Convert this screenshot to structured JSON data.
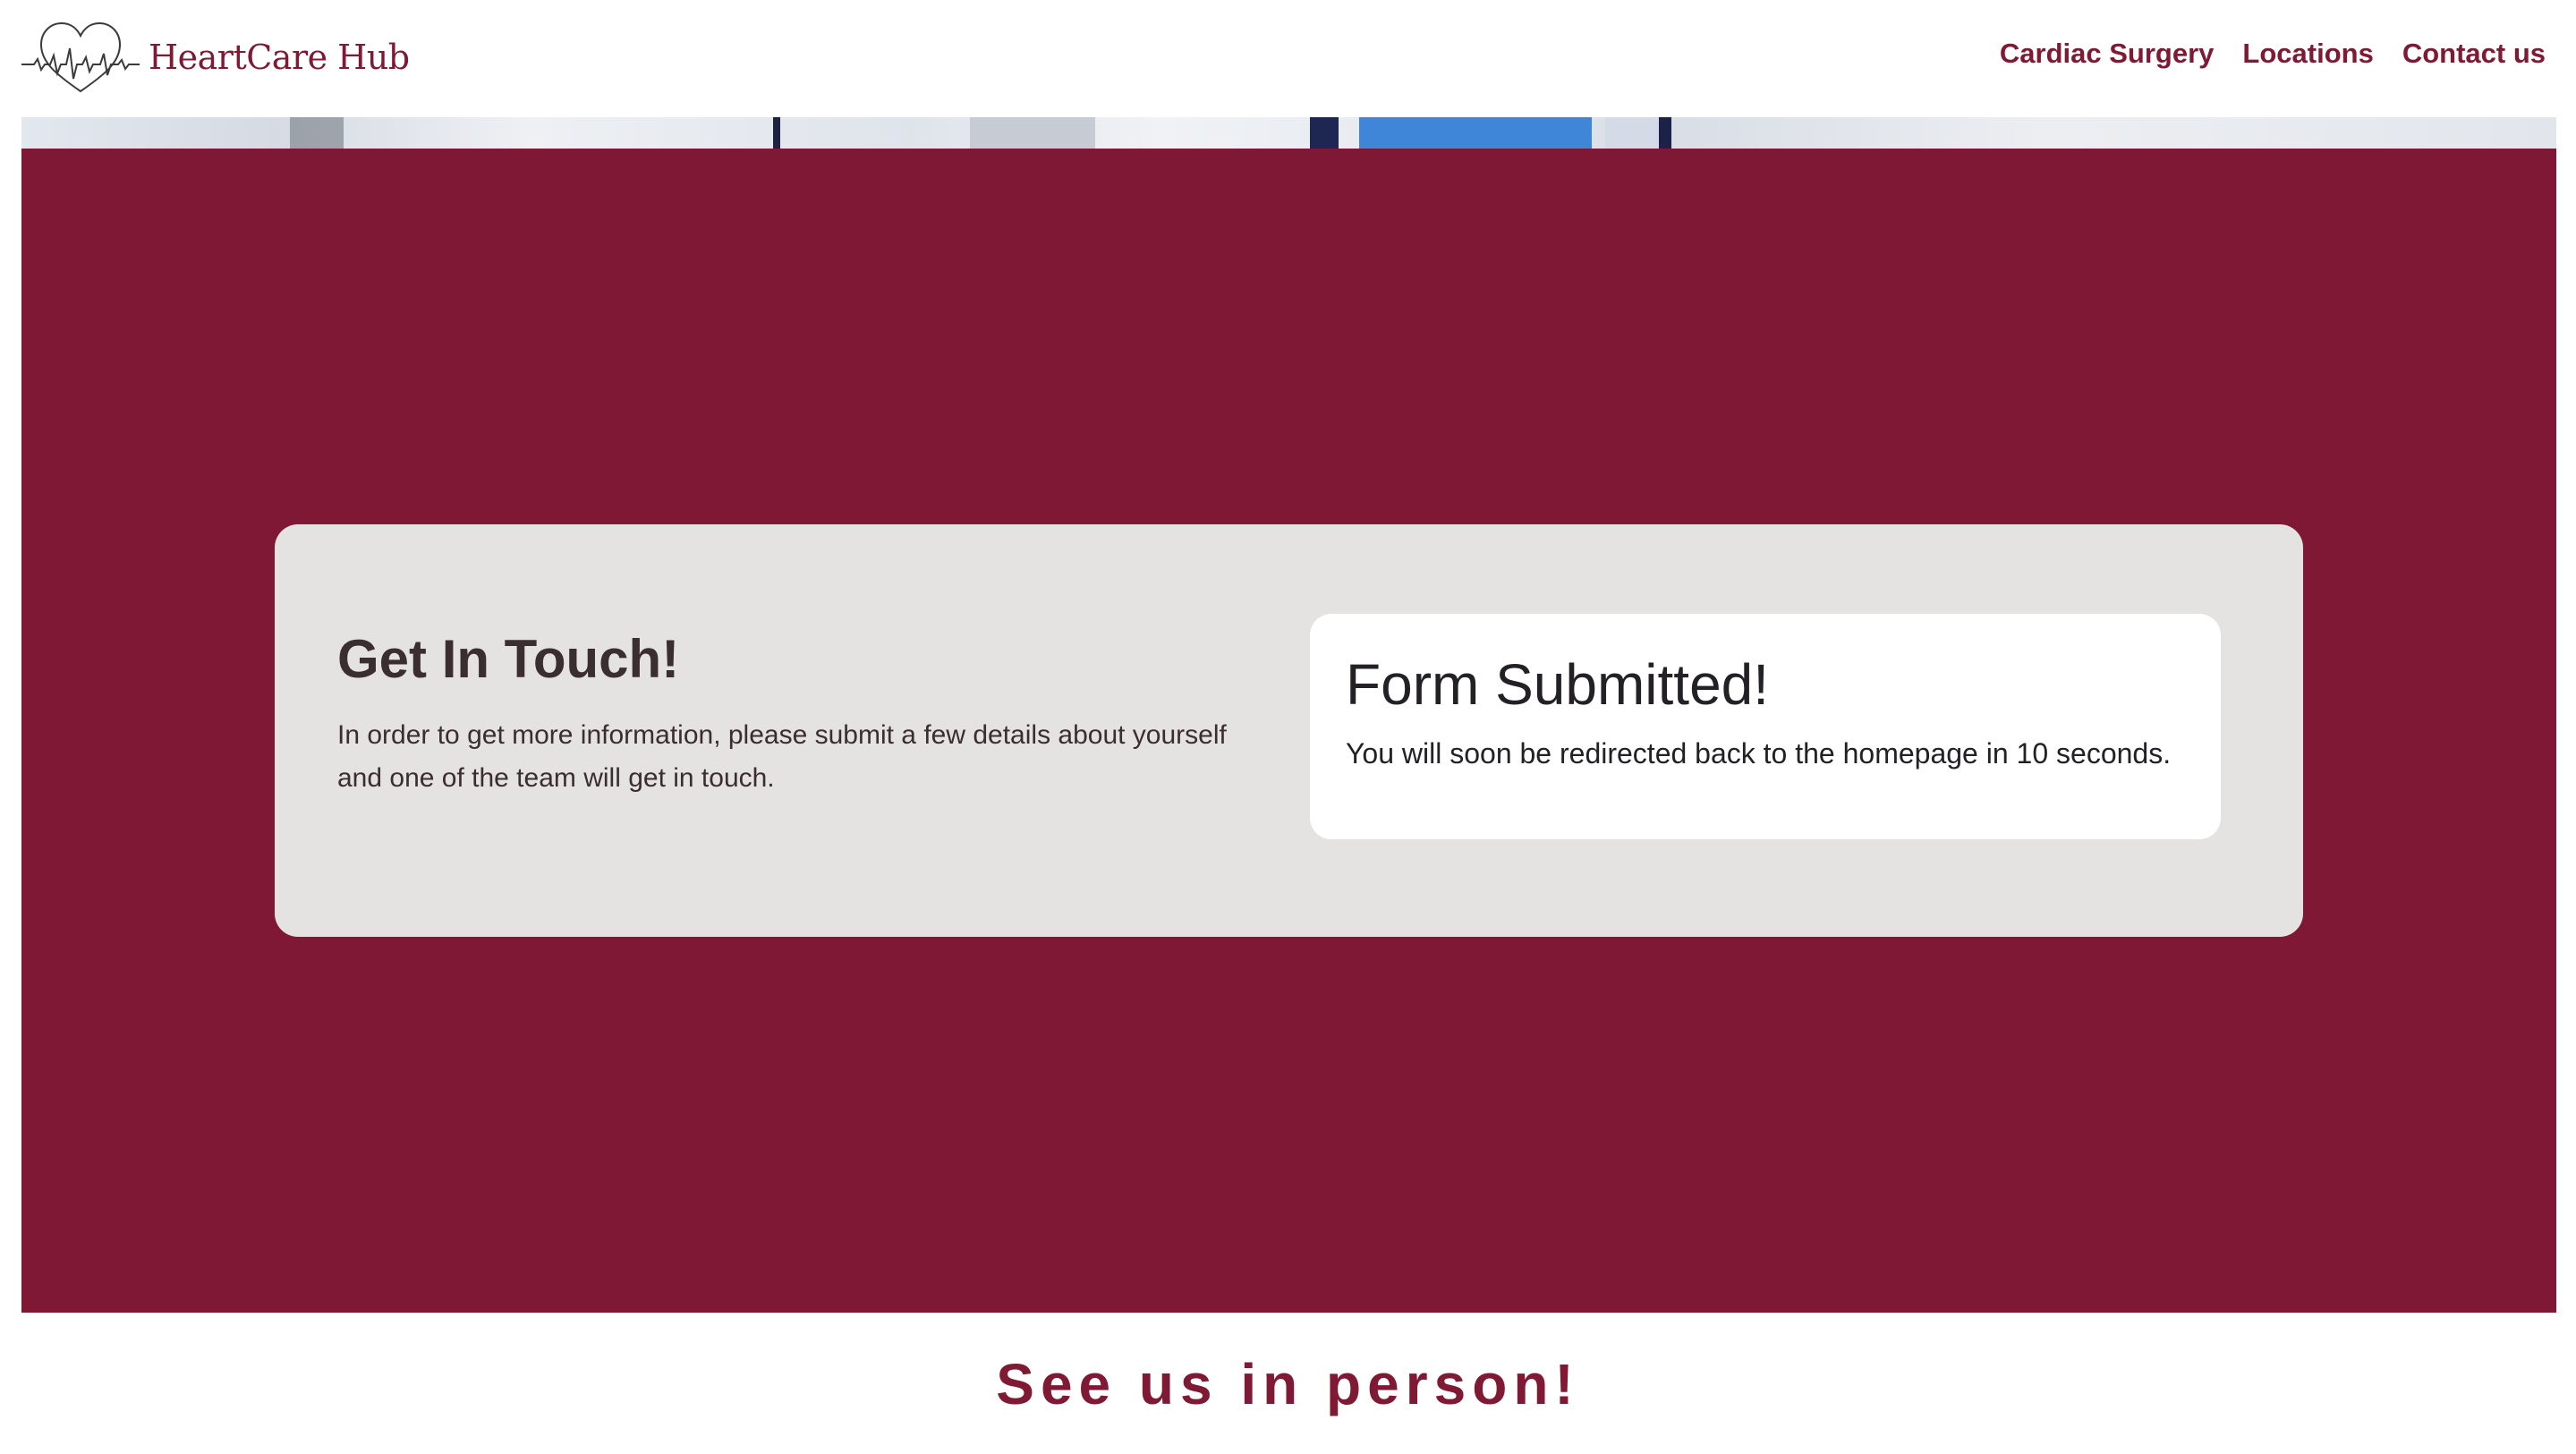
{
  "header": {
    "brand_name": "HeartCare Hub",
    "logo_icon": "heart-heartbeat-icon",
    "nav": [
      {
        "label": "Cardiac Surgery"
      },
      {
        "label": "Locations"
      },
      {
        "label": "Contact us"
      }
    ]
  },
  "contact": {
    "title": "Get In Touch!",
    "description": "In order to get more information, please submit a few details about yourself and one of the team will get in touch."
  },
  "confirmation": {
    "title": "Form Submitted!",
    "message": "You will soon be redirected back to the homepage in 10 seconds."
  },
  "locations_section": {
    "title": "See us in person!"
  },
  "colors": {
    "brand": "#7f1834",
    "card_background": "#e5e3e2",
    "confirm_background": "#ffffff",
    "text_dark": "#3a2e31"
  }
}
